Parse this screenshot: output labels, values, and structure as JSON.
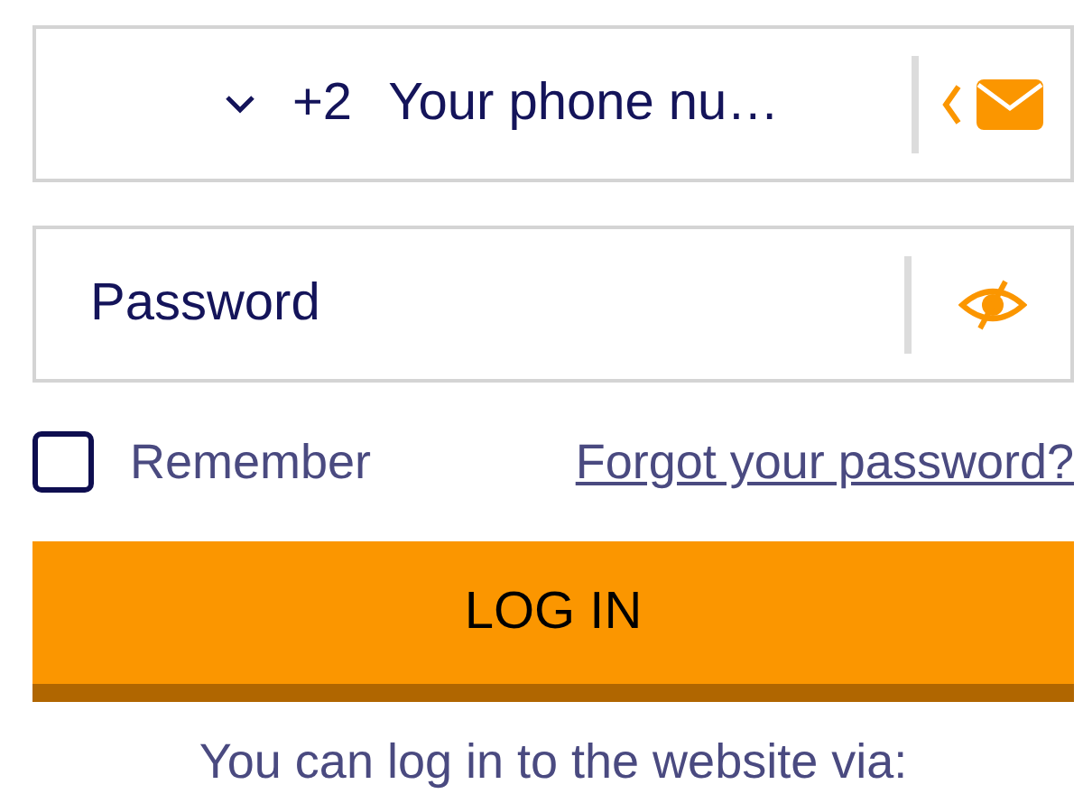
{
  "phone_field": {
    "country_code": "+2",
    "placeholder": "Your phone nu…"
  },
  "password_field": {
    "placeholder": "Password"
  },
  "remember": {
    "label": "Remember",
    "checked": false
  },
  "forgot_link": "Forgot your password?",
  "login_button": "LOG IN",
  "alt_login_text": "You can log in to the website via:"
}
